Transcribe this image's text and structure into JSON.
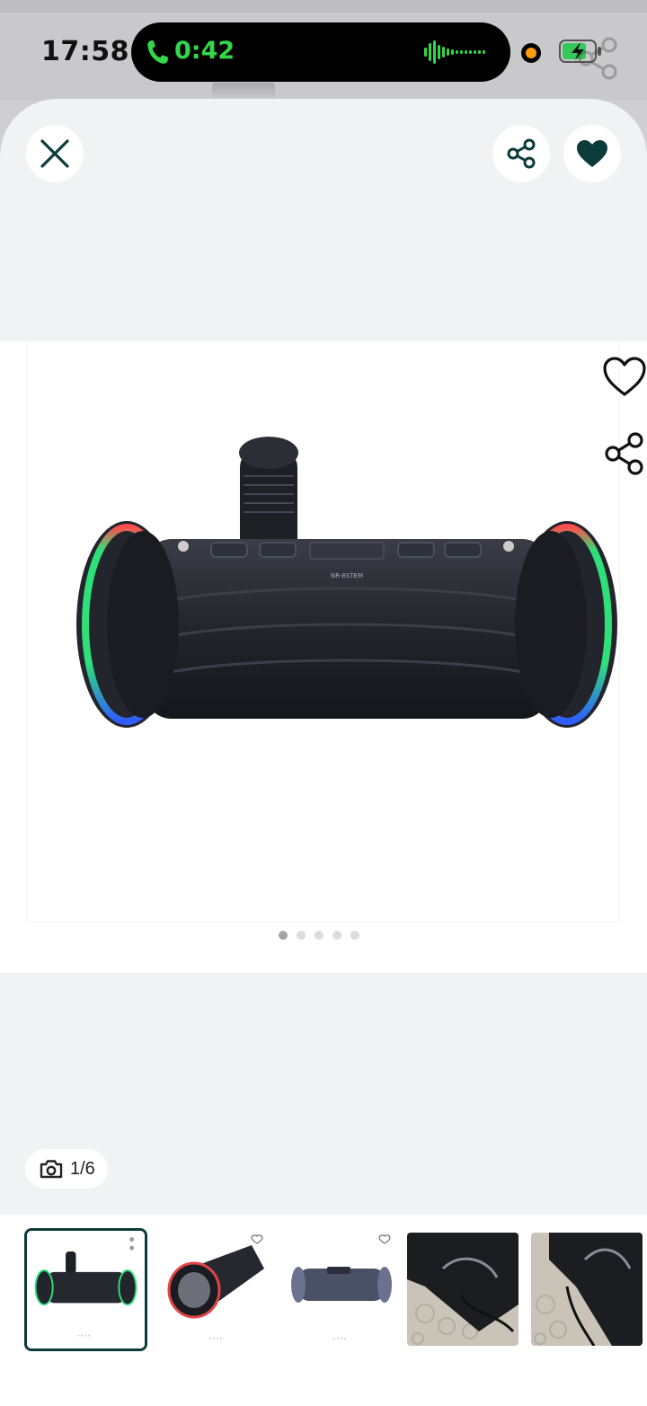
{
  "status_bar": {
    "time": "17:58",
    "call_duration": "0:42",
    "colors": {
      "call_green": "#32d74b",
      "battery_green": "#34c759",
      "mic_indicator": "#ff9f0a"
    }
  },
  "header": {
    "close_icon": "close-icon",
    "share_icon": "share-icon",
    "favorite_icon": "heart-filled-icon",
    "accent_color": "#0c3b3b"
  },
  "gallery": {
    "image_subject": "portable speaker with microphone",
    "speaker_label": "NR-8STEM",
    "image_count_total": 5,
    "active_dot": 1,
    "counter_text": "1/6"
  },
  "thumbnails": [
    {
      "kind": "speaker-front",
      "selected": true
    },
    {
      "kind": "speaker-angle",
      "selected": false
    },
    {
      "kind": "speaker-blue",
      "selected": false
    },
    {
      "kind": "photo-carpet",
      "selected": false
    },
    {
      "kind": "photo-carpet-2",
      "selected": false
    }
  ]
}
